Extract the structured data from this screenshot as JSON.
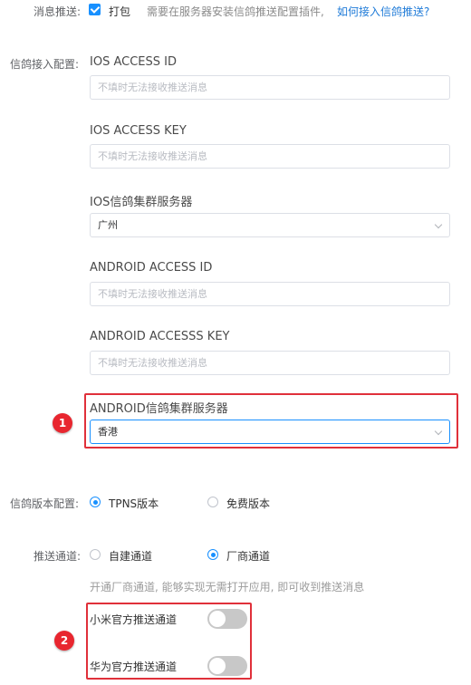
{
  "push": {
    "label": "消息推送:",
    "checkbox_label": "打包",
    "hint": "需要在服务器安装信鸽推送配置插件,",
    "link": "如何接入信鸽推送?"
  },
  "xg_config": {
    "label": "信鸽接入配置:",
    "fields": [
      {
        "title": "IOS ACCESS ID",
        "placeholder": "不填时无法接收推送消息"
      },
      {
        "title": "IOS ACCESS KEY",
        "placeholder": "不填时无法接收推送消息"
      },
      {
        "title": "IOS信鸽集群服务器",
        "value": "广州"
      },
      {
        "title": "ANDROID ACCESS ID",
        "placeholder": "不填时无法接收推送消息"
      },
      {
        "title": "ANDROID ACCESSS KEY",
        "placeholder": "不填时无法接收推送消息"
      },
      {
        "title": "ANDROID信鸽集群服务器",
        "value": "香港"
      }
    ]
  },
  "version": {
    "label": "信鸽版本配置:",
    "options": [
      {
        "label": "TPNS版本",
        "selected": true
      },
      {
        "label": "免费版本",
        "selected": false
      }
    ]
  },
  "channel": {
    "label": "推送通道:",
    "options": [
      {
        "label": "自建通道",
        "selected": false
      },
      {
        "label": "厂商通道",
        "selected": true
      }
    ],
    "hint": "开通厂商通道, 能够实现无需打开应用, 即可收到推送消息",
    "switches": [
      {
        "label": "小米官方推送通道",
        "on": false
      },
      {
        "label": "华为官方推送通道",
        "on": false
      }
    ]
  },
  "badges": [
    "1",
    "2"
  ],
  "colors": {
    "accent": "#1890ff",
    "highlight": "#e0303a",
    "link": "#1f7bd8"
  }
}
